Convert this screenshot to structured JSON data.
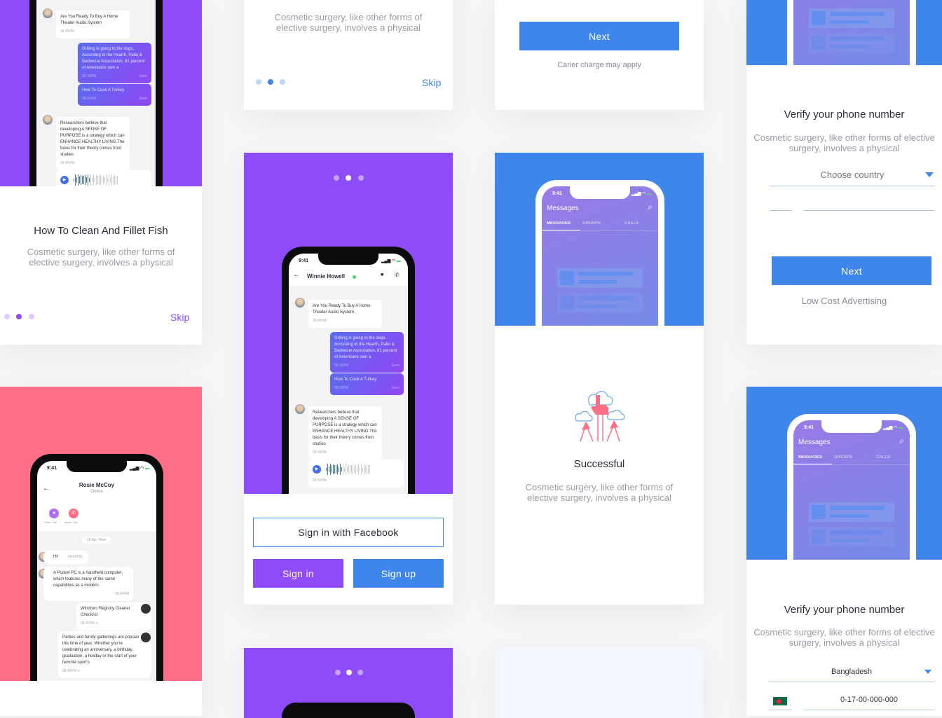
{
  "colors": {
    "purple": "#8e4cf8",
    "blue": "#3f86ec",
    "pink": "#fe6f86",
    "bg": "#f6f6f8"
  },
  "chat": {
    "time": "9:41",
    "contact": "Winnie Howell",
    "messages": [
      {
        "text": "Are You Ready To Buy A Home Theater Audio System",
        "time": "08:45PM",
        "me": false
      },
      {
        "text": "Grilling is going to the dogs. According to the Hearth, Patio & Barbecue Association, 81 percent of Americans own a",
        "time": "06:16PM",
        "status": "Seen",
        "me": true
      },
      {
        "text": "How To Cook A Turkey",
        "time": "08:03PM",
        "status": "Seen",
        "me": true
      },
      {
        "text": "Researchers believe that developing A SENSE OF PURPOSE is a strategy which can ENHANCE HEALTHY LIVING.The basis for their theory comes from studies",
        "time": "08:45PM",
        "me": false
      },
      {
        "audio": true,
        "time": "08:45PM"
      }
    ]
  },
  "onboarding": {
    "title": "How To Clean And Fillet Fish",
    "desc": "Cosmetic surgery, like other forms of elective surgery, involves a physical",
    "skip": "Skip"
  },
  "carrier": {
    "next": "Next",
    "note": "Carier charge may apply"
  },
  "verify": {
    "title": "Verify your phone number",
    "desc": "Cosmetic surgery, like other forms of elective surgery, involves a physical",
    "country_placeholder": "Choose country",
    "next": "Next",
    "note": "Low Cost Advertising",
    "country_selected": "Bangladesh",
    "phone_value": "0-17-00-000-000",
    "flag_icon": "bangladesh-flag-icon"
  },
  "rosie": {
    "time": "9:41",
    "name": "Rosie McCoy",
    "status": "Online",
    "video": "Video Call",
    "audio": "Audio Call",
    "date": "11 Apr, Wed",
    "m1": "Hi!",
    "m1t": "08:45PM",
    "m2": "A Pocket PC is a handheld computer, which features many of the same capabilities as a modern",
    "m2t": "08:45PM",
    "m3": "Windows Registry Cleaner Checklist",
    "m3t": "08:45PM ✔",
    "m4": "Parties and family gatherings are popular this time of year. Whether you're celebrating an anniversary, a birthday, graduation, a holiday or the start of your favorite sport's",
    "m4t": "08:45PM ✔"
  },
  "signin": {
    "facebook": "Sign in with Facebook",
    "signin": "Sign in",
    "signup": "Sign up"
  },
  "messages_app": {
    "time": "9:41",
    "title": "Messages",
    "tabs": [
      "MESSAGES",
      "GROUPS",
      "CALLS"
    ]
  },
  "success": {
    "title": "Successful",
    "desc": "Cosmetic surgery, like other forms of elective surgery, involves a physical"
  }
}
